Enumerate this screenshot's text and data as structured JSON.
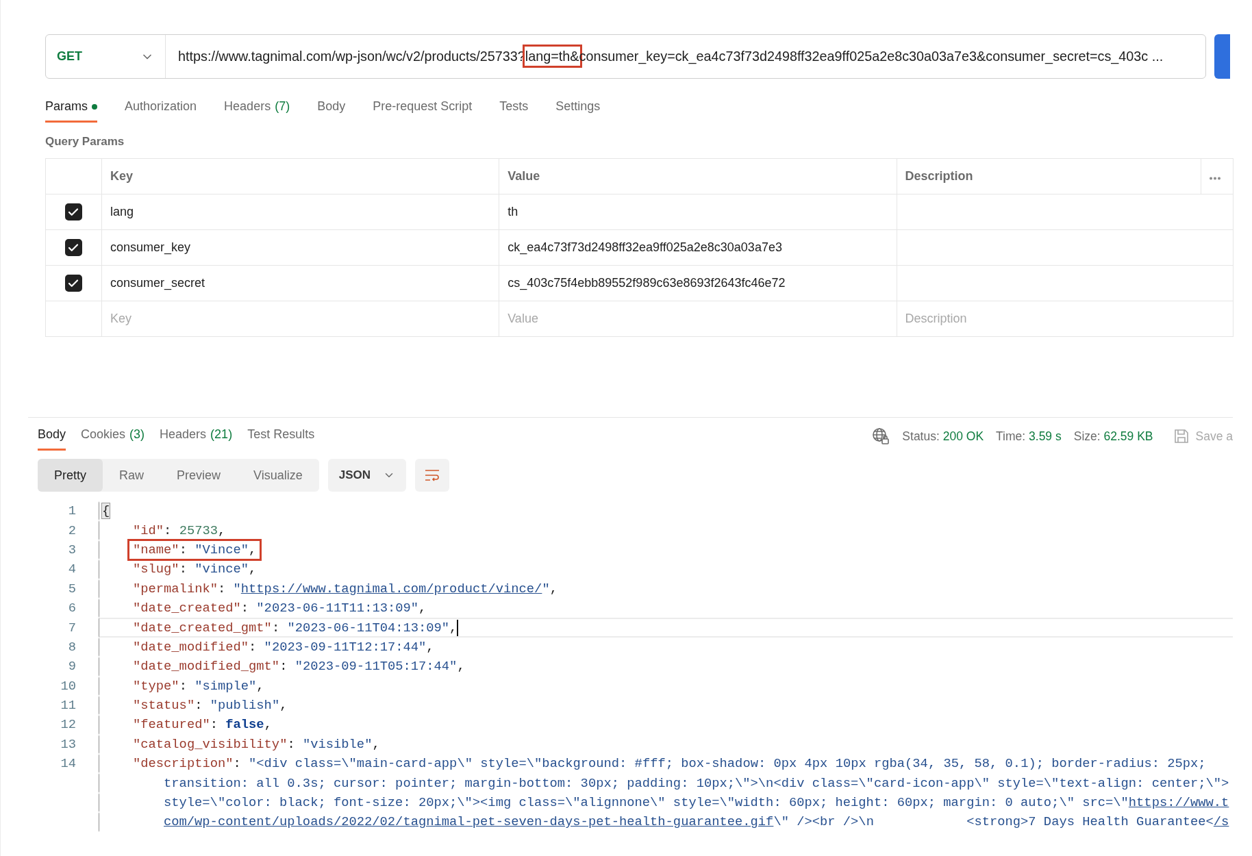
{
  "request": {
    "method": "GET",
    "url_parts": [
      {
        "text": "https://www.tagnimal.com/wp-json/wc/v2/products/25733?",
        "highlighted": false
      },
      {
        "text": "lang=th&",
        "highlighted": true
      },
      {
        "text": "consumer_key=ck_ea4c73f73d2498ff32ea9ff025a2e8c30a03a7e3&consumer_secret=cs_403c ...",
        "highlighted": false
      }
    ]
  },
  "request_tabs": [
    {
      "label": "Params",
      "dot": true,
      "selected": true
    },
    {
      "label": "Authorization",
      "dot": false,
      "selected": false
    },
    {
      "label": "Headers",
      "count": "(7)",
      "dot": false,
      "selected": false
    },
    {
      "label": "Body",
      "dot": false,
      "selected": false
    },
    {
      "label": "Pre-request Script",
      "dot": false,
      "selected": false
    },
    {
      "label": "Tests",
      "dot": false,
      "selected": false
    },
    {
      "label": "Settings",
      "dot": false,
      "selected": false
    }
  ],
  "query_params": {
    "title": "Query Params",
    "columns": [
      "Key",
      "Value",
      "Description"
    ],
    "rows": [
      {
        "checked": true,
        "key": "lang",
        "value": "th"
      },
      {
        "checked": true,
        "key": "consumer_key",
        "value": "ck_ea4c73f73d2498ff32ea9ff025a2e8c30a03a7e3"
      },
      {
        "checked": true,
        "key": "consumer_secret",
        "value": "cs_403c75f4ebb89552f989c63e8693f2643fc46e72"
      }
    ],
    "new_row": {
      "key": {
        "placeholder": "Key"
      },
      "value": {
        "placeholder": "Value"
      },
      "description": {
        "placeholder": "Description"
      }
    }
  },
  "response": {
    "tabs": [
      {
        "label": "Body",
        "selected": true
      },
      {
        "label": "Cookies",
        "count": "(3)",
        "selected": false
      },
      {
        "label": "Headers",
        "count": "(21)",
        "selected": false
      },
      {
        "label": "Test Results",
        "selected": false
      }
    ],
    "stats": [
      {
        "label": "Status:",
        "value": "200 OK"
      },
      {
        "label": "Time:",
        "value": "3.59 s"
      },
      {
        "label": "Size:",
        "value": "62.59 KB"
      }
    ],
    "save_label": "Save a",
    "view_modes": [
      {
        "label": "Pretty",
        "selected": true
      },
      {
        "label": "Raw",
        "selected": false
      },
      {
        "label": "Preview",
        "selected": false
      },
      {
        "label": "Visualize",
        "selected": false
      }
    ],
    "format": "JSON",
    "code": [
      {
        "num": "1",
        "tokens": [
          {
            "kind": "m",
            "text": "{"
          }
        ],
        "children": [
          {
            "num": "2",
            "tokens": [
              {
                "kind": "k",
                "text": "\"id\""
              },
              {
                "kind": "p",
                "text": ": "
              },
              {
                "kind": "n",
                "text": "25733"
              },
              {
                "kind": "p",
                "text": ","
              }
            ]
          },
          {
            "num": "3",
            "highlighted": true,
            "tokens": [
              {
                "kind": "k",
                "text": "\"name\""
              },
              {
                "kind": "p",
                "text": ": "
              },
              {
                "kind": "s",
                "text": "\"Vince\""
              },
              {
                "kind": "p",
                "text": ","
              }
            ]
          },
          {
            "num": "4",
            "tokens": [
              {
                "kind": "k",
                "text": "\"slug\""
              },
              {
                "kind": "p",
                "text": ": "
              },
              {
                "kind": "s",
                "text": "\"vince\""
              },
              {
                "kind": "p",
                "text": ","
              }
            ]
          },
          {
            "num": "5",
            "tokens": [
              {
                "kind": "k",
                "text": "\"permalink\""
              },
              {
                "kind": "p",
                "text": ": "
              },
              {
                "kind": "s",
                "text": "\""
              },
              {
                "kind": "l",
                "text": "https://www.tagnimal.com/product/vince/"
              },
              {
                "kind": "s",
                "text": "\""
              },
              {
                "kind": "p",
                "text": ","
              }
            ]
          },
          {
            "num": "6",
            "tokens": [
              {
                "kind": "k",
                "text": "\"date_created\""
              },
              {
                "kind": "p",
                "text": ": "
              },
              {
                "kind": "s",
                "text": "\"2023-06-11T11:13:09\""
              },
              {
                "kind": "p",
                "text": ","
              }
            ]
          },
          {
            "num": "7",
            "current": true,
            "tokens": [
              {
                "kind": "k",
                "text": "\"date_created_gmt\""
              },
              {
                "kind": "p",
                "text": ": "
              },
              {
                "kind": "s",
                "text": "\"2023-06-11T04:13:09\""
              },
              {
                "kind": "p",
                "text": ","
              }
            ]
          },
          {
            "num": "8",
            "tokens": [
              {
                "kind": "k",
                "text": "\"date_modified\""
              },
              {
                "kind": "p",
                "text": ": "
              },
              {
                "kind": "s",
                "text": "\"2023-09-11T12:17:44\""
              },
              {
                "kind": "p",
                "text": ","
              }
            ]
          },
          {
            "num": "9",
            "tokens": [
              {
                "kind": "k",
                "text": "\"date_modified_gmt\""
              },
              {
                "kind": "p",
                "text": ": "
              },
              {
                "kind": "s",
                "text": "\"2023-09-11T05:17:44\""
              },
              {
                "kind": "p",
                "text": ","
              }
            ]
          },
          {
            "num": "10",
            "tokens": [
              {
                "kind": "k",
                "text": "\"type\""
              },
              {
                "kind": "p",
                "text": ": "
              },
              {
                "kind": "s",
                "text": "\"simple\""
              },
              {
                "kind": "p",
                "text": ","
              }
            ]
          },
          {
            "num": "11",
            "tokens": [
              {
                "kind": "k",
                "text": "\"status\""
              },
              {
                "kind": "p",
                "text": ": "
              },
              {
                "kind": "s",
                "text": "\"publish\""
              },
              {
                "kind": "p",
                "text": ","
              }
            ]
          },
          {
            "num": "12",
            "tokens": [
              {
                "kind": "k",
                "text": "\"featured\""
              },
              {
                "kind": "p",
                "text": ": "
              },
              {
                "kind": "b",
                "text": "false"
              },
              {
                "kind": "p",
                "text": ","
              }
            ]
          },
          {
            "num": "13",
            "tokens": [
              {
                "kind": "k",
                "text": "\"catalog_visibility\""
              },
              {
                "kind": "p",
                "text": ": "
              },
              {
                "kind": "s",
                "text": "\"visible\""
              },
              {
                "kind": "p",
                "text": ","
              }
            ]
          },
          {
            "num": "14",
            "tokens": [
              {
                "kind": "k",
                "text": "\"description\""
              },
              {
                "kind": "p",
                "text": ": "
              },
              {
                "kind": "s",
                "text": "\"<div class=\\\"main-card-app\\\" style=\\\"background: #fff; box-shadow: 0px 4px 10px rgba(34, 35, 58, 0.1); border-radius: 25px;"
              }
            ],
            "wrap": [
              [
                {
                  "kind": "s",
                  "text": "transition: all 0.3s; cursor: pointer; margin-bottom: 30px; padding: 10px;\\\">\\n<div class=\\\"card-icon-app\\\" style=\\\"text-align: center;\\\">"
                }
              ],
              [
                {
                  "kind": "s",
                  "text": "style=\\\"color: black; font-size: 20px;\\\"><img class=\\\"alignnone\\\" style=\\\"width: 60px; height: 60px; margin: 0 auto;\\\" src=\\\""
                },
                {
                  "kind": "l",
                  "text": "https://www.t"
                }
              ],
              [
                {
                  "kind": "l",
                  "text": "com/wp-content/uploads/2022/02/tagnimal-pet-seven-days-pet-health-guarantee.gif"
                },
                {
                  "kind": "s",
                  "text": "\\\" /><br />\\n            <strong>7 Days Health Guarantee<"
                },
                {
                  "kind": "l",
                  "text": "/s"
                }
              ]
            ]
          }
        ]
      }
    ]
  }
}
